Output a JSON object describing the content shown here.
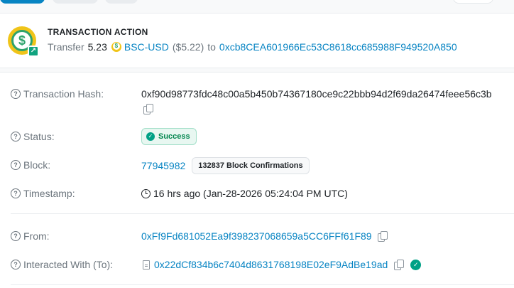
{
  "action": {
    "title": "TRANSACTION ACTION",
    "verb": "Transfer",
    "amount": "5.23",
    "token": "BSC-USD",
    "usd_value": "($5.22)",
    "to_word": "to",
    "to_address": "0xcb8CEA601966Ec53C8618cc685988F949520A850"
  },
  "details": {
    "hash": {
      "label": "Transaction Hash:",
      "value": "0xf90d98773fdc48c00a5b450b74367180ce9c22bbb94d2f69da26474feee56c3b"
    },
    "status": {
      "label": "Status:",
      "value": "Success"
    },
    "block": {
      "label": "Block:",
      "value": "77945982",
      "confirmations": "132837 Block Confirmations"
    },
    "timestamp": {
      "label": "Timestamp:",
      "value": "16 hrs ago (Jan-28-2026 05:24:04 PM UTC)"
    },
    "from": {
      "label": "From:",
      "value": "0xFf9Fd681052Ea9f398237068659a5CC6FFf61F89"
    },
    "to": {
      "label": "Interacted With (To):",
      "value": "0x22dCf834b6c7404d8631768198E02eF9AdBe19ad"
    }
  },
  "icons": {
    "help": "question-circle-icon",
    "copy": "copy-icon",
    "clock": "clock-icon",
    "contract": "document-icon",
    "verified": "check-circle-icon",
    "token": "dollar-coin-icon"
  },
  "colors": {
    "link": "#0784c3",
    "success": "#00a186",
    "muted": "#6c757d"
  }
}
